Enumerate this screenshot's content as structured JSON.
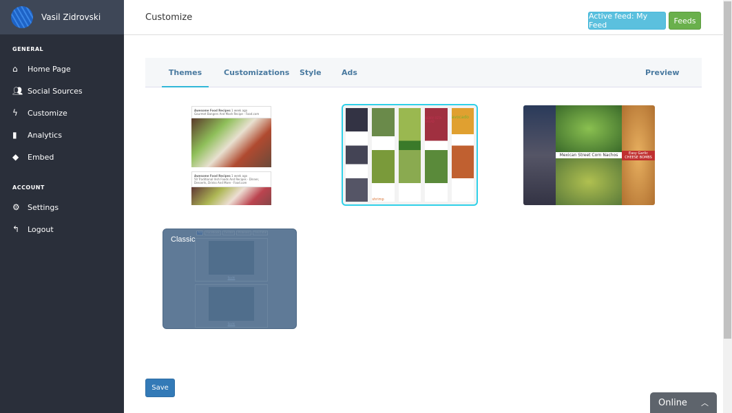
{
  "user": {
    "name": "Vasil Zidrovski"
  },
  "sidebar": {
    "general_label": "GENERAL",
    "account_label": "ACCOUNT",
    "general": [
      {
        "label": "Home Page",
        "icon": "home-icon"
      },
      {
        "label": "Social Sources",
        "icon": "users-icon"
      },
      {
        "label": "Customize",
        "icon": "bolt-icon"
      },
      {
        "label": "Analytics",
        "icon": "bar-chart-icon"
      },
      {
        "label": "Embed",
        "icon": "tag-icon"
      }
    ],
    "account": [
      {
        "label": "Settings",
        "icon": "gear-icon"
      },
      {
        "label": "Logout",
        "icon": "reply-icon"
      }
    ]
  },
  "header": {
    "title": "Customize",
    "active_feed": "Active feed: My Feed",
    "feeds": "Feeds"
  },
  "tabs": [
    {
      "label": "Themes",
      "active": true
    },
    {
      "label": "Customizations"
    },
    {
      "label": "Style"
    },
    {
      "label": "Ads"
    },
    {
      "label": "Preview"
    }
  ],
  "themes": {
    "t1": {
      "source": "Awesome Food Recipes",
      "time": "1 week ago",
      "post1": "Gourmet Bangers And Mash Recipe - Food.com",
      "post2": "50 Traditional Irish Foods And Recipes - Dinner, Desserts, Drinks And More - Food.com"
    },
    "t2": {
      "caption1": "BERRY FETA SALAD",
      "caption2": "avocado",
      "caption3": "shrimp"
    },
    "t3": {
      "caption1": "Mexican Street Corn Nachos",
      "caption2": "Easy Garlic CHEESE BOMBS"
    },
    "classic": {
      "label": "Classic",
      "filters": [
        "All",
        "Facebook",
        "Twitter",
        "Pinterest",
        "YouTube"
      ],
      "link": "Sochi"
    }
  },
  "save": "Save",
  "chat": {
    "label": "Online"
  },
  "colors": {
    "sidebar": "#2a2f3a",
    "accent": "#2fb6d8",
    "info": "#5bc0de",
    "success": "#6ab04c",
    "primary": "#337ab7"
  }
}
